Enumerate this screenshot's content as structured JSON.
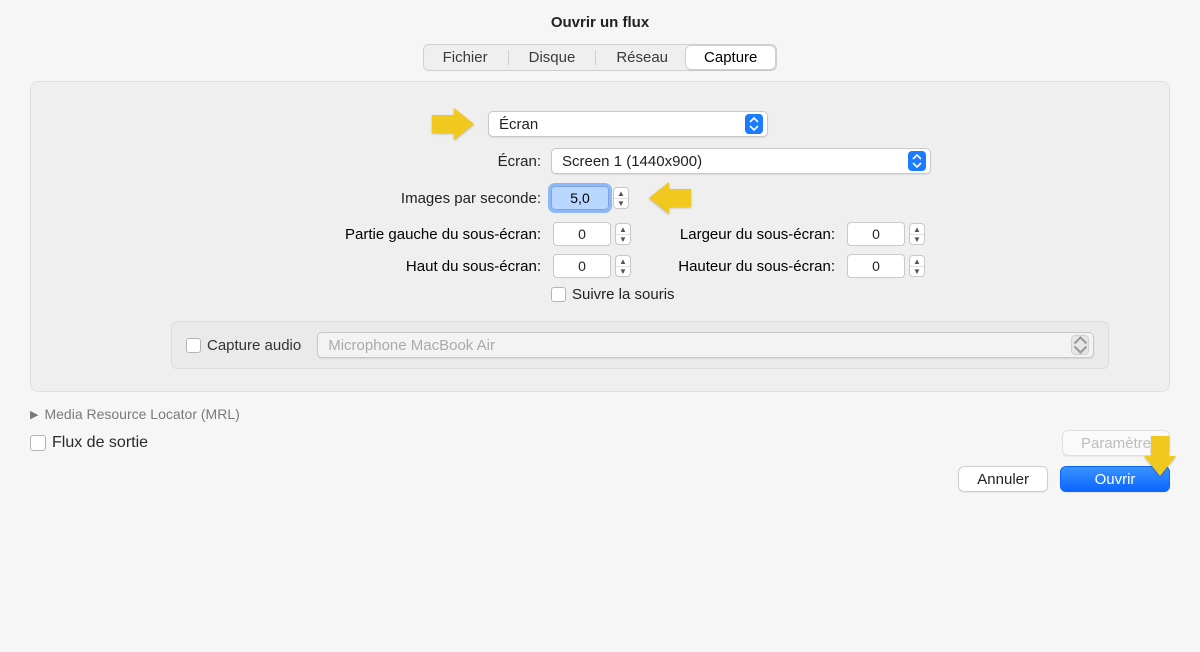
{
  "title": "Ouvrir un flux",
  "tabs": {
    "file": "Fichier",
    "disk": "Disque",
    "network": "Réseau",
    "capture": "Capture",
    "active": "capture"
  },
  "capture": {
    "source_value": "Écran",
    "screen_label": "Écran:",
    "screen_value": "Screen 1 (1440x900)",
    "fps_label": "Images par seconde:",
    "fps_value": "5,0",
    "sub_left_label": "Partie gauche du sous-écran:",
    "sub_left_value": "0",
    "sub_top_label": "Haut du sous-écran:",
    "sub_top_value": "0",
    "sub_width_label": "Largeur du sous-écran:",
    "sub_width_value": "0",
    "sub_height_label": "Hauteur du sous-écran:",
    "sub_height_value": "0",
    "follow_mouse_label": "Suivre la souris",
    "audio_capture_label": "Capture audio",
    "audio_device_value": "Microphone MacBook Air"
  },
  "mrl_label": "Media Resource Locator (MRL)",
  "output_stream_label": "Flux de sortie",
  "buttons": {
    "settings": "Paramètre",
    "cancel": "Annuler",
    "open": "Ouvrir"
  }
}
